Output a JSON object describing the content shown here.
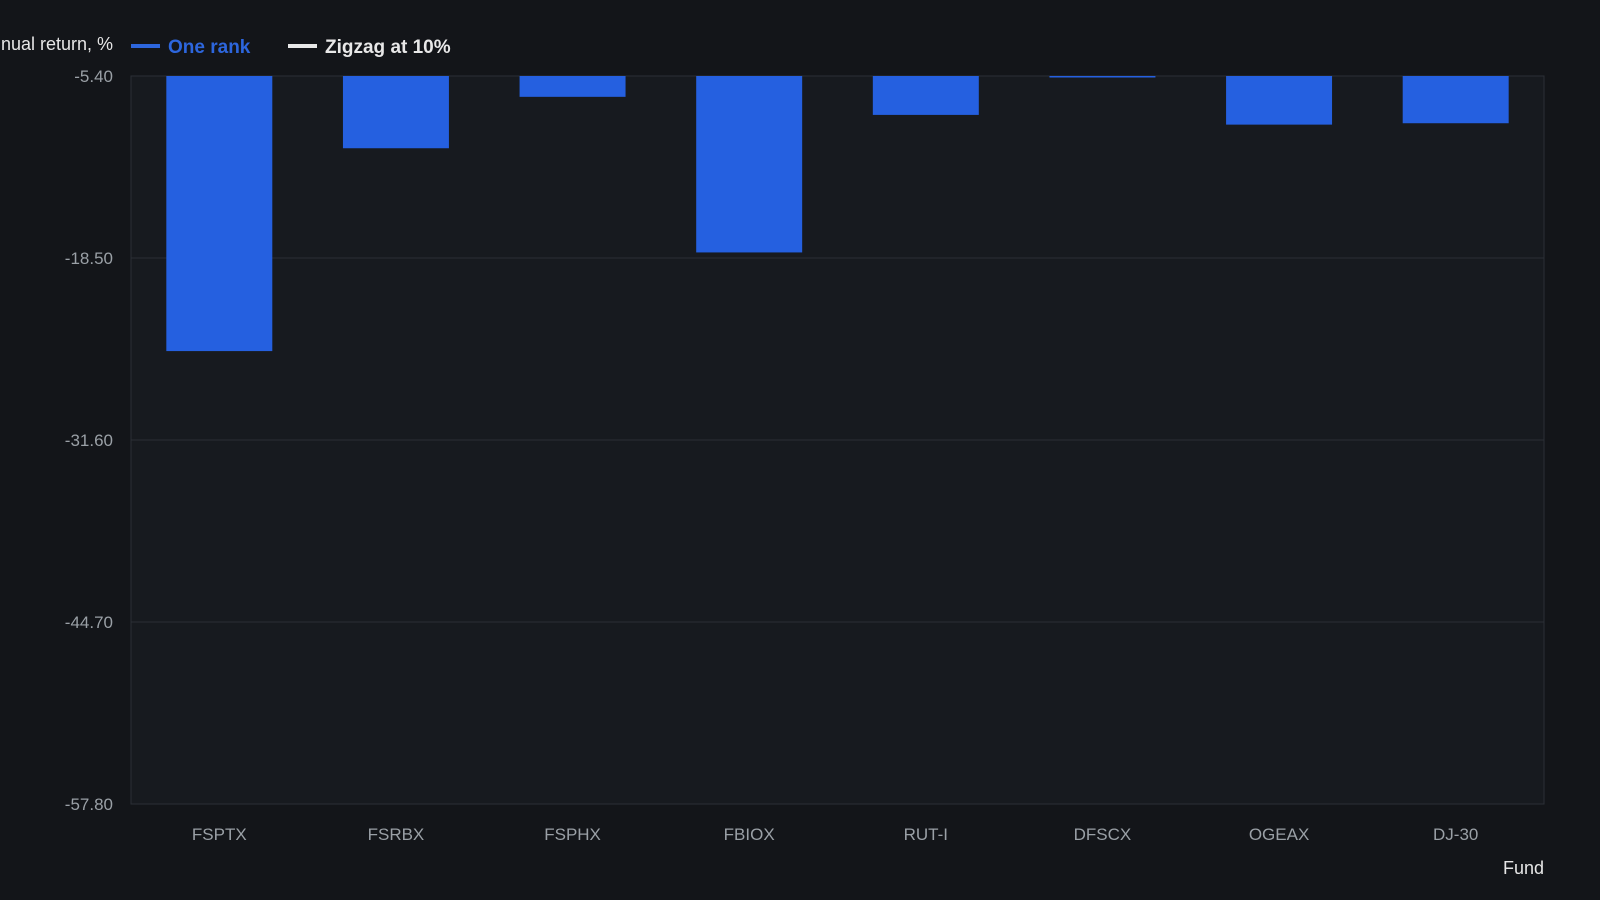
{
  "colors": {
    "background": "#131519",
    "plot_background": "#171a1f",
    "grid": "#2b2f36",
    "bar": "#2560e0",
    "legend_one": "#2d66dd",
    "legend_two": "#e8e8e8",
    "axis_text": "#9aa0a6",
    "label_text": "#e6e6e6"
  },
  "chart_data": {
    "type": "bar",
    "xlabel": "Fund",
    "ylabel": "Annual return, %",
    "categories": [
      "FSPTX",
      "FSRBX",
      "FSPHX",
      "FBIOX",
      "RUT-I",
      "DFSCX",
      "OGEAX",
      "DJ-30"
    ],
    "series": [
      {
        "name": "One rank",
        "values": [
          -25.2,
          -10.6,
          -6.9,
          -18.1,
          -8.2,
          -5.5,
          -8.9,
          -8.8
        ]
      }
    ],
    "legend": [
      "One rank",
      "Zigzag at 10%"
    ],
    "legend_placement": "top-left",
    "ylim": [
      -57.8,
      -5.4
    ],
    "yticks": [
      "-5.40",
      "-18.50",
      "-31.60",
      "-44.70",
      "-57.80"
    ],
    "grid": true
  }
}
